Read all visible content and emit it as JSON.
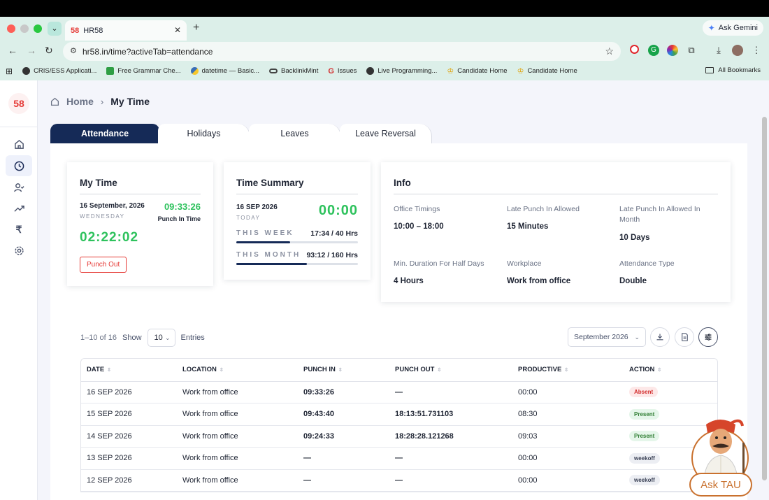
{
  "browser": {
    "tab_title": "HR58",
    "tab_favicon": "58",
    "url": "hr58.in/time?activeTab=attendance",
    "ask_gemini": "Ask Gemini",
    "bookmarks": [
      {
        "label": "CRIS/ESS Applicati...",
        "color": "#333333"
      },
      {
        "label": "Free Grammar Che...",
        "color": "#2e9e44"
      },
      {
        "label": "datetime — Basic...",
        "color": "#3b6fb6"
      },
      {
        "label": "BacklinkMint",
        "color": "#444444"
      },
      {
        "label": "Issues",
        "color": "#d32f2f"
      },
      {
        "label": "Live Programming...",
        "color": "#333333"
      },
      {
        "label": "Candidate Home",
        "color": "#e0a000"
      },
      {
        "label": "Candidate Home",
        "color": "#e0a000"
      }
    ],
    "all_bookmarks": "All Bookmarks"
  },
  "app": {
    "logo": "58",
    "breadcrumb": {
      "home": "Home",
      "current": "My Time"
    },
    "tabs": [
      "Attendance",
      "Holidays",
      "Leaves",
      "Leave Reversal"
    ],
    "my_time": {
      "title": "My Time",
      "date": "16 September, 2026",
      "weekday": "WEDNESDAY",
      "punch_in_time": "09:33:26",
      "punch_in_label": "Punch In Time",
      "elapsed": "02:22:02",
      "punch_out_button": "Punch Out"
    },
    "time_summary": {
      "title": "Time Summary",
      "date": "16 SEP 2026",
      "today_label": "TODAY",
      "today_total": "00:00",
      "week_label": "THIS WEEK",
      "week_value": "17:34 / 40 Hrs",
      "week_fraction": 0.44,
      "month_label": "THIS MONTH",
      "month_value": "93:12 / 160 Hrs",
      "month_fraction": 0.58
    },
    "info": {
      "title": "Info",
      "items": [
        {
          "label": "Office Timings",
          "value": "10:00 – 18:00"
        },
        {
          "label": "Late Punch In Allowed",
          "value": "15 Minutes"
        },
        {
          "label": "Late Punch In Allowed In Month",
          "value": "10 Days"
        },
        {
          "label": "Min. Duration For Half Days",
          "value": "4 Hours"
        },
        {
          "label": "Workplace",
          "value": "Work from office"
        },
        {
          "label": "Attendance Type",
          "value": "Double"
        }
      ]
    },
    "list": {
      "range": "1–10 of 16",
      "show_label": "Show",
      "entries_value": "10",
      "entries_label": "Entries",
      "month_filter": "September 2026"
    },
    "table": {
      "columns": [
        "DATE",
        "LOCATION",
        "PUNCH IN",
        "PUNCH OUT",
        "PRODUCTIVE",
        "ACTION"
      ],
      "rows": [
        {
          "date": "16 SEP 2026",
          "location": "Work from office",
          "punch_in": "09:33:26",
          "punch_out": "—",
          "productive": "00:00",
          "status": "Absent",
          "status_type": "absent"
        },
        {
          "date": "15 SEP 2026",
          "location": "Work from office",
          "punch_in": "09:43:40",
          "punch_out": "18:13:51.731103",
          "productive": "08:30",
          "status": "Present",
          "status_type": "present"
        },
        {
          "date": "14 SEP 2026",
          "location": "Work from office",
          "punch_in": "09:24:33",
          "punch_out": "18:28:28.121268",
          "productive": "09:03",
          "status": "Present",
          "status_type": "present"
        },
        {
          "date": "13 SEP 2026",
          "location": "Work from office",
          "punch_in": "—",
          "punch_out": "—",
          "productive": "00:00",
          "status": "weekoff",
          "status_type": "weekoff"
        },
        {
          "date": "12 SEP 2026",
          "location": "Work from office",
          "punch_in": "—",
          "punch_out": "—",
          "productive": "00:00",
          "status": "weekoff",
          "status_type": "weekoff"
        }
      ]
    },
    "ask_tau": "Ask TAU"
  },
  "colors": {
    "brand_dark": "#152a57",
    "accent_green": "#2ec25d",
    "brand_red": "#e53935"
  }
}
